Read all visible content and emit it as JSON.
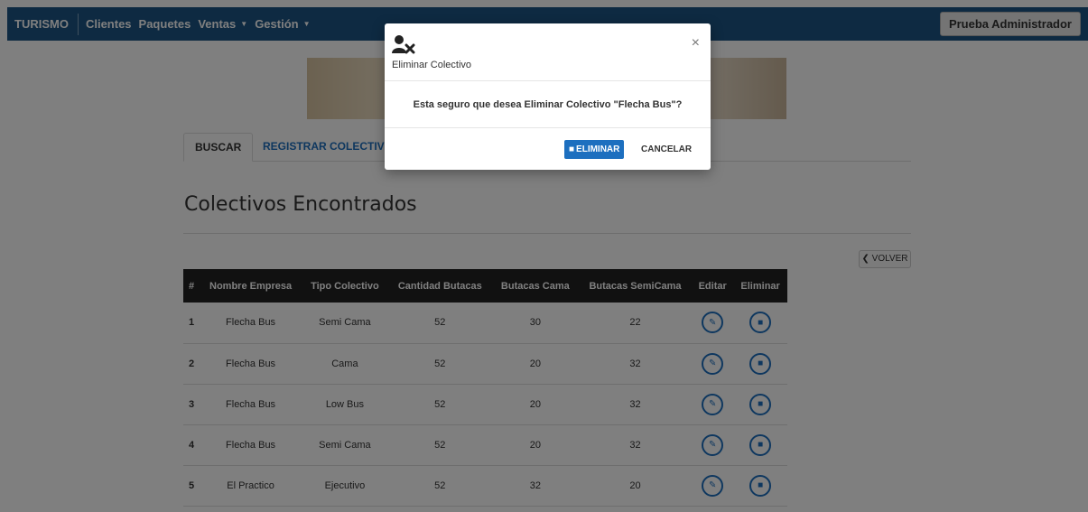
{
  "navbar": {
    "brand": "TURISMO",
    "links": [
      "Clientes",
      "Paquetes",
      "Ventas",
      "Gestión"
    ],
    "user": "Prueba Administrador"
  },
  "tabs": {
    "search": "BUSCAR",
    "register": "REGISTRAR COLECTIVO"
  },
  "page": {
    "title": "Colectivos Encontrados",
    "back": "VOLVER"
  },
  "table": {
    "headers": [
      "#",
      "Nombre Empresa",
      "Tipo Colectivo",
      "Cantidad Butacas",
      "Butacas Cama",
      "Butacas SemiCama",
      "Editar",
      "Eliminar"
    ],
    "rows": [
      {
        "n": "1",
        "empresa": "Flecha Bus",
        "tipo": "Semi Cama",
        "cantidad": "52",
        "cama": "30",
        "semicama": "22"
      },
      {
        "n": "2",
        "empresa": "Flecha Bus",
        "tipo": "Cama",
        "cantidad": "52",
        "cama": "20",
        "semicama": "32"
      },
      {
        "n": "3",
        "empresa": "Flecha Bus",
        "tipo": "Low Bus",
        "cantidad": "52",
        "cama": "20",
        "semicama": "32"
      },
      {
        "n": "4",
        "empresa": "Flecha Bus",
        "tipo": "Semi Cama",
        "cantidad": "52",
        "cama": "20",
        "semicama": "32"
      },
      {
        "n": "5",
        "empresa": "El Practico",
        "tipo": "Ejecutivo",
        "cantidad": "52",
        "cama": "32",
        "semicama": "20"
      }
    ]
  },
  "modal": {
    "title": "Eliminar Colectivo",
    "message": "Esta seguro que desea Eliminar Colectivo \"Flecha Bus\"?",
    "confirm": "ELIMINAR",
    "cancel": "CANCELAR",
    "close": "×"
  },
  "colors": {
    "navbar": "#1d5584",
    "primary": "#1d6fbf",
    "table_header": "#222222"
  },
  "icons": {
    "modal": "user-remove-icon",
    "edit": "edit-icon",
    "delete": "trash-icon",
    "back": "chevron-left-icon",
    "dropdown": "caret-down-icon"
  }
}
